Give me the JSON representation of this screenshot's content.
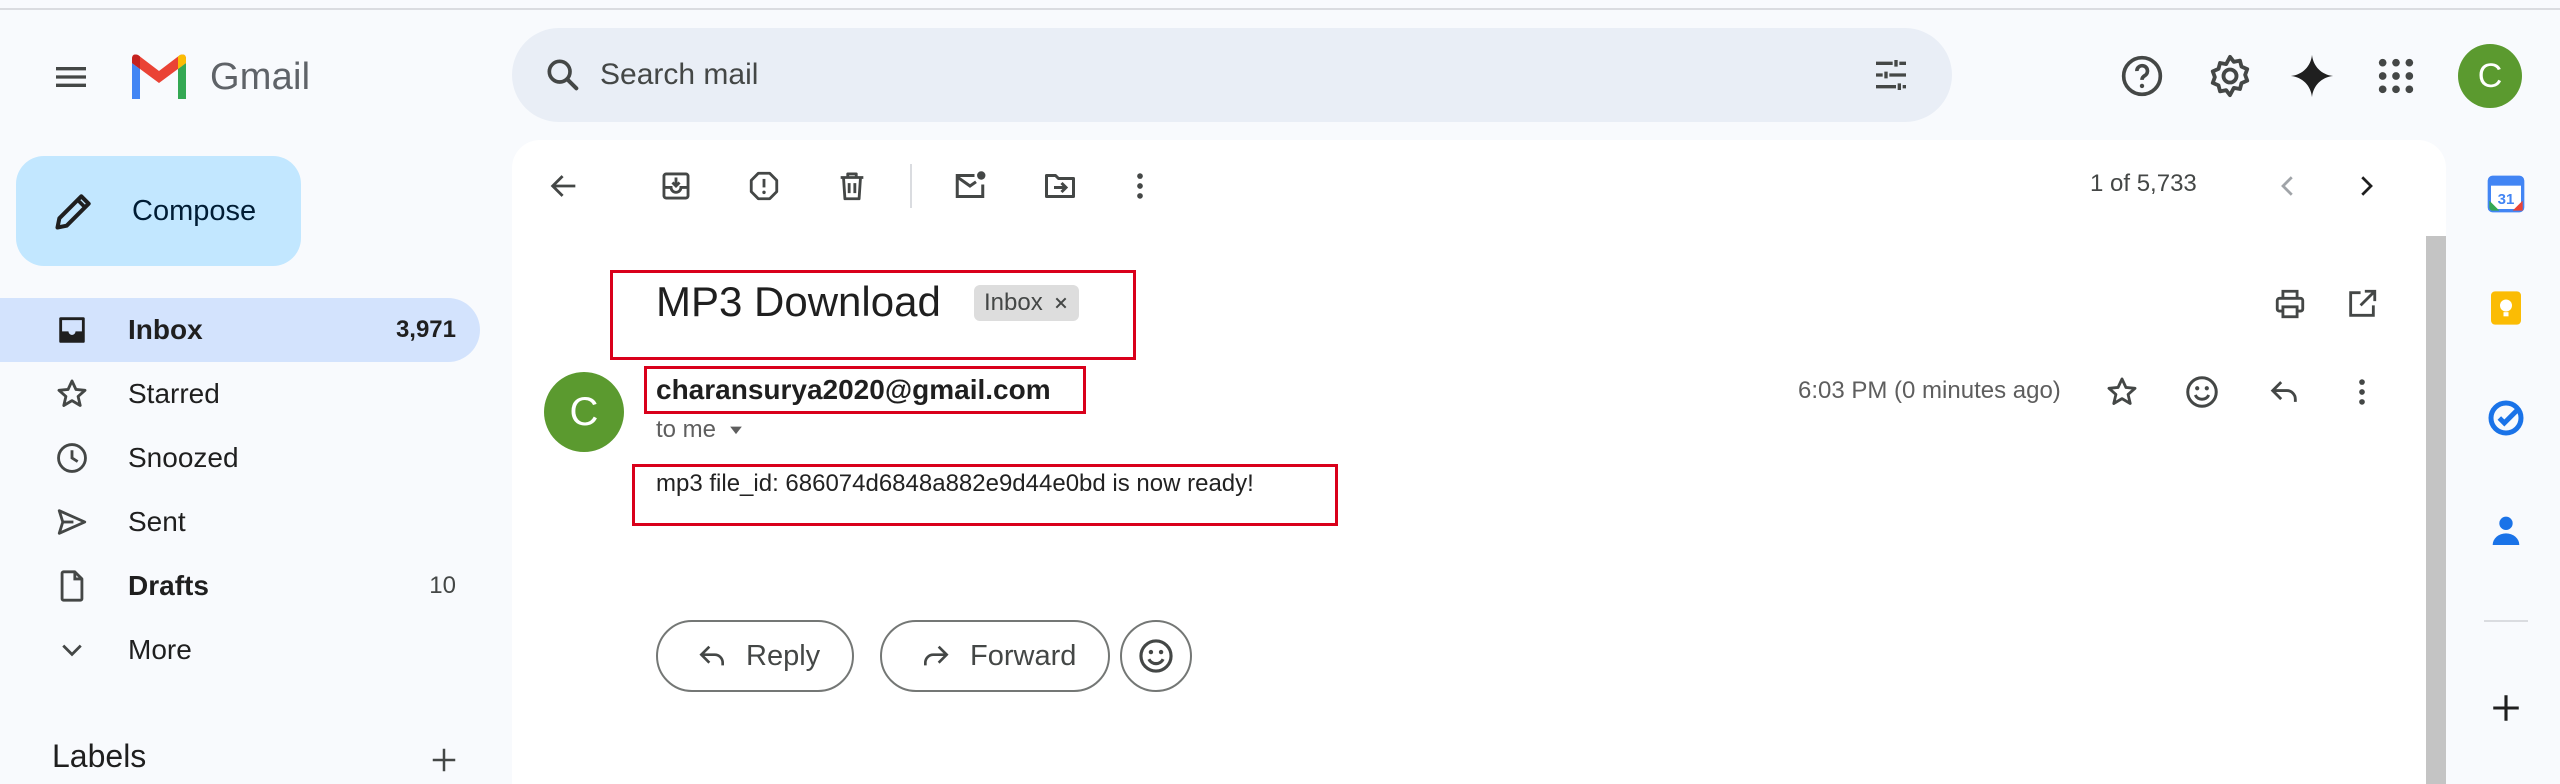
{
  "app": {
    "name": "Gmail",
    "icons": [
      "menu-icon",
      "gmail-logo",
      "search-icon",
      "tune-icon",
      "help-icon",
      "gear-icon",
      "gemini-icon",
      "apps-icon"
    ],
    "avatar_letter": "C"
  },
  "search": {
    "placeholder": "Search mail"
  },
  "sidebar": {
    "compose_label": "Compose",
    "items": [
      {
        "label": "Inbox",
        "count": "3,971",
        "icon": "inbox-icon"
      },
      {
        "label": "Starred",
        "count": "",
        "icon": "star-icon"
      },
      {
        "label": "Snoozed",
        "count": "",
        "icon": "clock-icon"
      },
      {
        "label": "Sent",
        "count": "",
        "icon": "send-icon"
      },
      {
        "label": "Drafts",
        "count": "10",
        "icon": "draft-icon"
      },
      {
        "label": "More",
        "count": "",
        "icon": "chevron-down-icon"
      }
    ],
    "labels_title": "Labels"
  },
  "toolbar": {
    "pager": "1 of 5,733"
  },
  "email": {
    "subject": "MP3 Download",
    "label_chip": "Inbox",
    "sender": "charansurya2020@gmail.com",
    "sender_avatar_letter": "C",
    "to": "to me",
    "time": "6:03 PM (0 minutes ago)",
    "body": "mp3 file_id: 686074d6848a882e9d44e0bd is now ready!",
    "reply_label": "Reply",
    "forward_label": "Forward"
  },
  "colors": {
    "accent": "#c2e7ff",
    "active_nav": "#d3e3fd",
    "avatar": "#5b9a2f",
    "highlight_box": "#d9001b"
  }
}
